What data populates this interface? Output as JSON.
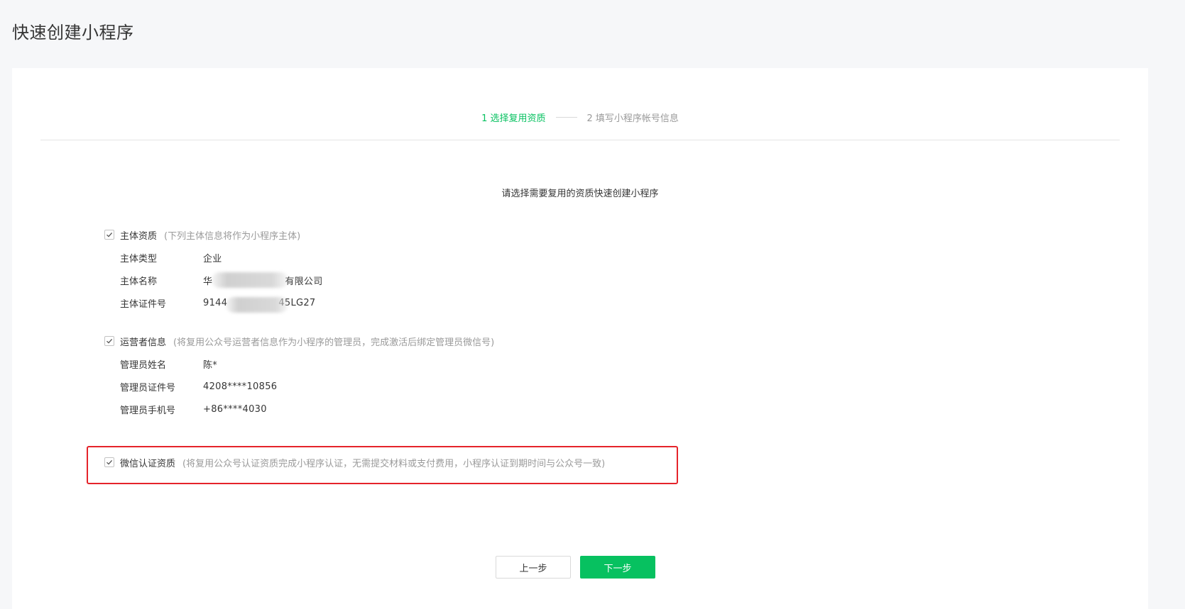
{
  "page": {
    "title": "快速创建小程序"
  },
  "steps": [
    {
      "label": "1 选择复用资质",
      "active": true
    },
    {
      "label": "2 填写小程序帐号信息",
      "active": false
    }
  ],
  "subtitle": "请选择需要复用的资质快速创建小程序",
  "sections": {
    "entity": {
      "label": "主体资质",
      "hint": "(下列主体信息将作为小程序主体)",
      "checked": true,
      "rows": [
        {
          "key": "主体类型",
          "value": "企业"
        },
        {
          "key": "主体名称",
          "value_prefix": "华",
          "value_suffix": "有限公司"
        },
        {
          "key": "主体证件号",
          "value_prefix": "9144",
          "value_suffix": "45LG27"
        }
      ]
    },
    "operator": {
      "label": "运营者信息",
      "hint": "(将复用公众号运营者信息作为小程序的管理员，完成激活后绑定管理员微信号)",
      "checked": true,
      "rows": [
        {
          "key": "管理员姓名",
          "value": "陈*"
        },
        {
          "key": "管理员证件号",
          "value": "4208****10856"
        },
        {
          "key": "管理员手机号",
          "value": "+86****4030"
        }
      ]
    },
    "wechat_cert": {
      "label": "微信认证资质",
      "hint": "(将复用公众号认证资质完成小程序认证，无需提交材料或支付费用，小程序认证到期时间与公众号一致)",
      "checked": true
    }
  },
  "buttons": {
    "prev": "上一步",
    "next": "下一步"
  },
  "colors": {
    "accent": "#07c160",
    "highlight": "#e5232a"
  }
}
